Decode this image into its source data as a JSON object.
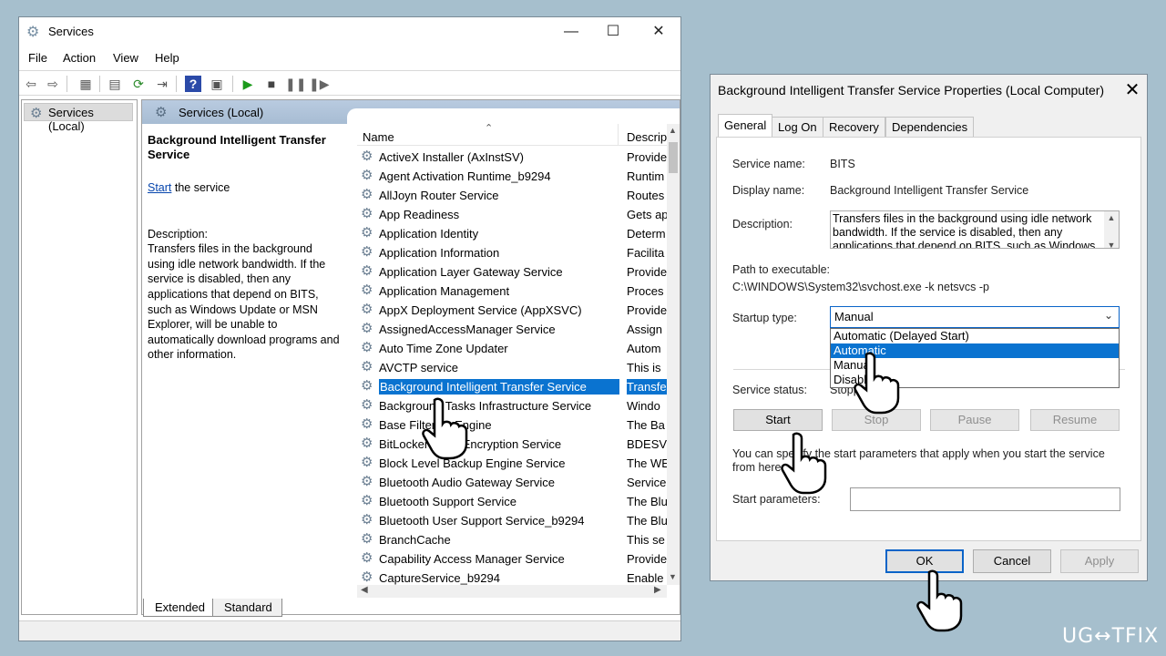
{
  "services_window": {
    "title": "Services",
    "menu": [
      "File",
      "Action",
      "View",
      "Help"
    ],
    "tree_item": "Services (Local)",
    "header_label": "Services (Local)",
    "detail": {
      "title": "Background Intelligent Transfer Service",
      "start_link": "Start",
      "start_suffix": " the service",
      "description_label": "Description:",
      "description": "Transfers files in the background using idle network bandwidth. If the service is disabled, then any applications that depend on BITS, such as Windows Update or MSN Explorer, will be unable to automatically download programs and other information."
    },
    "columns": {
      "name": "Name",
      "description": "Descrip"
    },
    "rows": [
      {
        "name": "ActiveX Installer (AxInstSV)",
        "desc": "Provide"
      },
      {
        "name": "Agent Activation Runtime_b9294",
        "desc": "Runtim"
      },
      {
        "name": "AllJoyn Router Service",
        "desc": "Routes"
      },
      {
        "name": "App Readiness",
        "desc": "Gets ap"
      },
      {
        "name": "Application Identity",
        "desc": "Determ"
      },
      {
        "name": "Application Information",
        "desc": "Facilita"
      },
      {
        "name": "Application Layer Gateway Service",
        "desc": "Provide"
      },
      {
        "name": "Application Management",
        "desc": "Proces"
      },
      {
        "name": "AppX Deployment Service (AppXSVC)",
        "desc": "Provide"
      },
      {
        "name": "AssignedAccessManager Service",
        "desc": "Assign"
      },
      {
        "name": "Auto Time Zone Updater",
        "desc": "Autom"
      },
      {
        "name": "AVCTP service",
        "desc": "This is"
      },
      {
        "name": "Background Intelligent Transfer Service",
        "desc": "Transfe"
      },
      {
        "name": "Background Tasks Infrastructure Service",
        "desc": "Windo"
      },
      {
        "name": "Base Filtering Engine",
        "desc": "The Ba"
      },
      {
        "name": "BitLocker Drive Encryption Service",
        "desc": "BDESV"
      },
      {
        "name": "Block Level Backup Engine Service",
        "desc": "The WE"
      },
      {
        "name": "Bluetooth Audio Gateway Service",
        "desc": "Service"
      },
      {
        "name": "Bluetooth Support Service",
        "desc": "The Blu"
      },
      {
        "name": "Bluetooth User Support Service_b9294",
        "desc": "The Blu"
      },
      {
        "name": "BranchCache",
        "desc": "This se"
      },
      {
        "name": "Capability Access Manager Service",
        "desc": "Provide"
      },
      {
        "name": "CaptureService_b9294",
        "desc": "Enable"
      }
    ],
    "bottom_tabs": [
      "Extended",
      "Standard"
    ]
  },
  "dialog": {
    "title": "Background Intelligent Transfer Service Properties (Local Computer)",
    "tabs": [
      "General",
      "Log On",
      "Recovery",
      "Dependencies"
    ],
    "service_name_label": "Service name:",
    "service_name": "BITS",
    "display_name_label": "Display name:",
    "display_name": "Background Intelligent Transfer Service",
    "description_label": "Description:",
    "description": "Transfers files in the background using idle network bandwidth. If the service is disabled, then any applications that depend on BITS, such as Windows",
    "path_label": "Path to executable:",
    "path": "C:\\WINDOWS\\System32\\svchost.exe -k netsvcs -p",
    "startup_label": "Startup type:",
    "startup_value": "Manual",
    "startup_options": [
      "Automatic (Delayed Start)",
      "Automatic",
      "Manual",
      "Disabled"
    ],
    "status_label": "Service status:",
    "status_value": "Stopped",
    "buttons": {
      "start": "Start",
      "stop": "Stop",
      "pause": "Pause",
      "resume": "Resume"
    },
    "note": "You can specify the start parameters that apply when you start the service from here.",
    "params_label": "Start parameters:",
    "ok": "OK",
    "cancel": "Cancel",
    "apply": "Apply"
  },
  "watermark": "UG↔TFIX",
  "colors": {
    "desktop": "#a6bfcd",
    "selection": "#0a73d0",
    "link": "#0645ad"
  }
}
